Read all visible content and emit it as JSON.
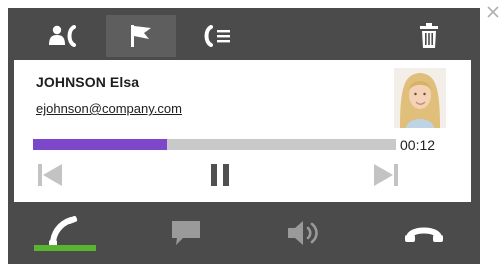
{
  "contact": {
    "name": "JOHNSON Elsa",
    "email": "ejohnson@company.com"
  },
  "playback": {
    "elapsed": "00:12",
    "progress_fraction": 0.37
  },
  "colors": {
    "panel": "#4b4b4b",
    "accent_progress": "#7d47c9",
    "active_call": "#59b52f"
  },
  "icons": {
    "toolbar": [
      "contact-icon",
      "flag-icon",
      "call-list-icon",
      "trash-icon"
    ],
    "controls": [
      "skip-previous-icon",
      "pause-icon",
      "skip-next-icon"
    ],
    "bottom": [
      "phone-icon",
      "chat-icon",
      "volume-icon",
      "hang-up-icon"
    ],
    "window": "close-icon"
  }
}
